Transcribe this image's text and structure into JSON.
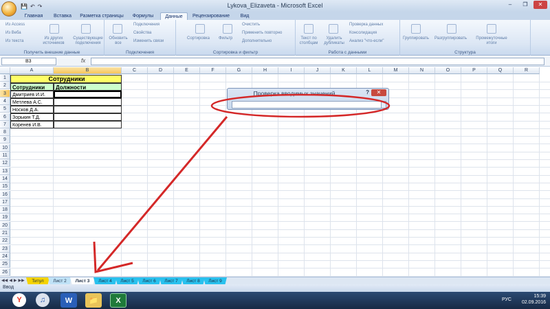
{
  "window": {
    "title": "Lykova_Elizaveta  -  Microsoft Excel",
    "minimize": "–",
    "maximize": "❐",
    "close": "✕"
  },
  "qat": {
    "save": "💾",
    "undo": "↶",
    "redo": "↷"
  },
  "tabs": [
    {
      "label": "Главная",
      "active": false
    },
    {
      "label": "Вставка",
      "active": false
    },
    {
      "label": "Разметка страницы",
      "active": false
    },
    {
      "label": "Формулы",
      "active": false
    },
    {
      "label": "Данные",
      "active": true
    },
    {
      "label": "Рецензирование",
      "active": false
    },
    {
      "label": "Вид",
      "active": false
    }
  ],
  "ribbon": {
    "groups": [
      {
        "label": "Получить внешние данные",
        "items": [
          "Из Access",
          "Из Веба",
          "Из текста",
          "Из других источников",
          "Существующие подключения"
        ]
      },
      {
        "label": "Подключения",
        "items": [
          "Обновить все",
          "Подключения",
          "Свойства",
          "Изменить связи"
        ]
      },
      {
        "label": "Сортировка и фильтр",
        "items": [
          "Сортировка",
          "Фильтр",
          "Очистить",
          "Применить повторно",
          "Дополнительно"
        ]
      },
      {
        "label": "Работа с данными",
        "items": [
          "Текст по столбцам",
          "Удалить дубликаты",
          "Проверка данных",
          "Консолидация",
          "Анализ \"что-если\""
        ]
      },
      {
        "label": "Структура",
        "items": [
          "Группировать",
          "Разгруппировать",
          "Промежуточные итоги"
        ]
      }
    ]
  },
  "formula_bar": {
    "name_box": "B3",
    "fx": "fx",
    "value": ""
  },
  "columns": [
    "A",
    "B",
    "C",
    "D",
    "E",
    "F",
    "G",
    "H",
    "I",
    "J",
    "K",
    "L",
    "M",
    "N",
    "O",
    "P",
    "Q",
    "R"
  ],
  "rows": [
    "1",
    "2",
    "3",
    "4",
    "5",
    "6",
    "7",
    "8",
    "9",
    "10",
    "11",
    "12",
    "13",
    "14",
    "15",
    "16",
    "17",
    "18",
    "19",
    "20",
    "21",
    "22",
    "23",
    "24",
    "25",
    "26"
  ],
  "cells": {
    "title": "Сотрудники",
    "header_a": "Сотрудники",
    "header_b": "Должности",
    "employees": [
      "Дмитриев  И.И.",
      "Метлева А.С.",
      "Носков Д.А.",
      "Зорькин Т.Д.",
      "Коренев И.В."
    ]
  },
  "dialog": {
    "title": "Проверка вводимых значений",
    "help": "?",
    "close": "✕",
    "value": ""
  },
  "sheet_tabs": [
    {
      "label": "Титул",
      "color": "#f5d300",
      "active": false
    },
    {
      "label": "Лист 2",
      "color": "#bfe2f7",
      "active": false
    },
    {
      "label": "Лист 3",
      "color": "#ffffff",
      "active": true
    },
    {
      "label": "Лист 4",
      "color": "#29c1ee",
      "active": false
    },
    {
      "label": "Лист 5",
      "color": "#29c1ee",
      "active": false
    },
    {
      "label": "Лист 6",
      "color": "#29c1ee",
      "active": false
    },
    {
      "label": "Лист 7",
      "color": "#29c1ee",
      "active": false
    },
    {
      "label": "Лист 8",
      "color": "#29c1ee",
      "active": false
    },
    {
      "label": "Лист 9",
      "color": "#29c1ee",
      "active": false
    }
  ],
  "status": {
    "mode": "Ввод"
  },
  "taskbar": {
    "apps": [
      "Y",
      "♫",
      "W",
      "📁",
      "X"
    ],
    "lang": "РУС",
    "time": "15:39",
    "date": "02.09.2016"
  },
  "colors": {
    "annotation": "#d42828",
    "title_fill": "#ffff66",
    "header_fill": "#ccffcc",
    "tab_blue": "#29c1ee"
  }
}
